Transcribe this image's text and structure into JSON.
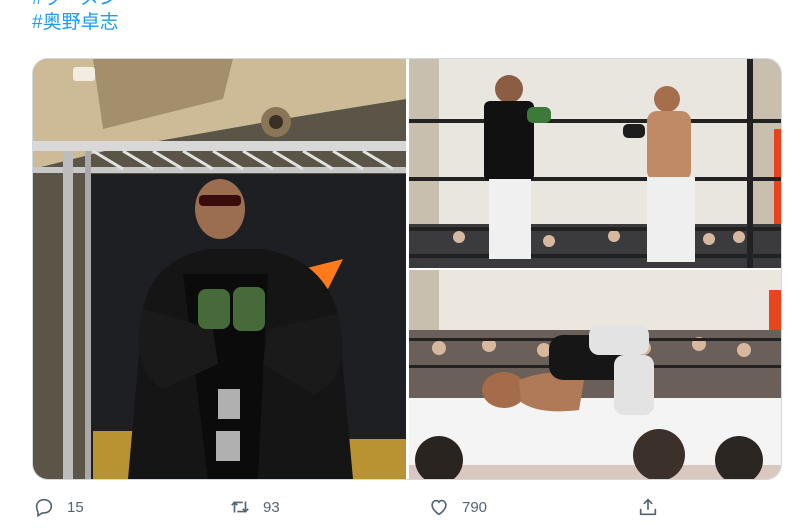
{
  "tweet": {
    "hashtags": [
      "#ラーメン",
      "#奥野卓志"
    ]
  },
  "photos": [
    {
      "name": "photo-wrestler-entrance"
    },
    {
      "name": "photo-ring-sparring"
    },
    {
      "name": "photo-ring-grappling"
    }
  ],
  "actions": {
    "reply_count": "15",
    "retweet_count": "93",
    "like_count": "790"
  },
  "icons": {
    "reply": "reply-icon",
    "retweet": "retweet-icon",
    "like": "heart-icon",
    "share": "share-icon"
  },
  "colors": {
    "link": "#1d9bf0",
    "action_gray": "#536471",
    "border": "#cfd9de"
  }
}
